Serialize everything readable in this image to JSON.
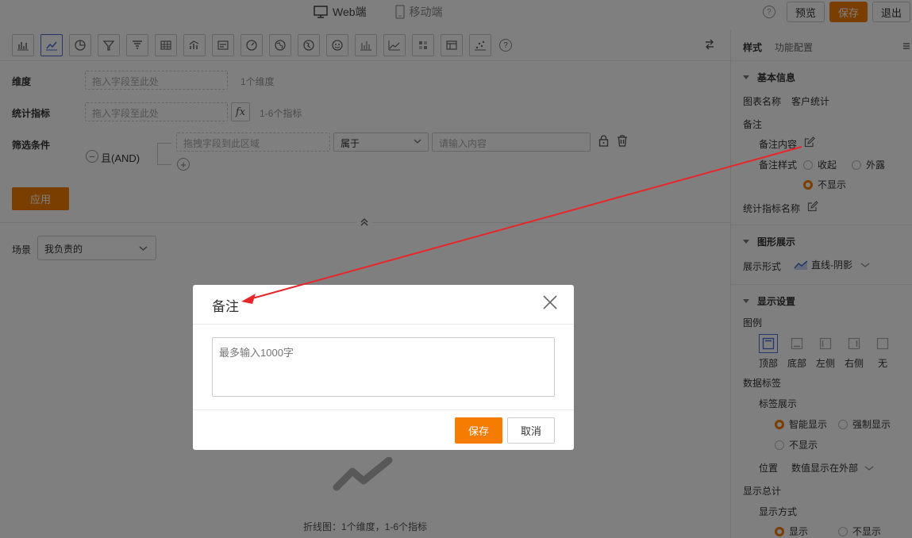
{
  "topbar": {
    "web_label": "Web端",
    "mobile_label": "移动端",
    "preview": "预览",
    "save": "保存",
    "exit": "退出"
  },
  "toolbar": {
    "chart_types": [
      "bar-chart-icon",
      "line-chart-icon",
      "pie-chart-icon",
      "funnel-icon",
      "funnel-alt-icon",
      "table-icon",
      "combo-chart-icon",
      "card-icon",
      "gauge-icon",
      "map-icon",
      "globe-icon",
      "dashboard-icon",
      "column-icon",
      "area-chart-icon",
      "matrix-icon",
      "detail-table-icon",
      "scatter-icon"
    ],
    "active_index": 1
  },
  "dimension": {
    "label": "维度",
    "placeholder": "拖入字段至此处",
    "hint": "1个维度"
  },
  "metric": {
    "label": "统计指标",
    "placeholder": "拖入字段至此处",
    "hint": "1-6个指标"
  },
  "filter": {
    "label": "筛选条件",
    "logic": "且(AND)",
    "field_placeholder": "拖拽字段到此区域",
    "operator": "属于",
    "value_placeholder": "请输入内容"
  },
  "apply_label": "应用",
  "scene": {
    "label": "场景",
    "value": "我负责的"
  },
  "empty": {
    "text": "折线图：1个维度，1-6个指标"
  },
  "panel": {
    "tabs": [
      "样式",
      "功能配置"
    ],
    "basic": {
      "title": "基本信息",
      "chart_name_label": "图表名称",
      "chart_name_value": "客户统计",
      "remark_label": "备注",
      "remark_content_label": "备注内容",
      "remark_style_label": "备注样式",
      "remark_styles": [
        "收起",
        "外露",
        "不显示"
      ],
      "metric_name_label": "统计指标名称"
    },
    "graph": {
      "title": "图形展示",
      "display_label": "展示形式",
      "display_value": "直线-阴影"
    },
    "display": {
      "title": "显示设置",
      "legend_label": "图例",
      "legend_options": [
        "顶部",
        "底部",
        "左侧",
        "右侧",
        "无"
      ],
      "data_label": "数据标签",
      "label_show": "标签展示",
      "label_options": [
        "智能显示",
        "强制显示",
        "不显示"
      ],
      "position_label": "位置",
      "position_value": "数值显示在外部",
      "total_label": "显示总计",
      "total_mode_label": "显示方式",
      "total_options": [
        "显示",
        "不显示"
      ]
    }
  },
  "modal": {
    "title": "备注",
    "placeholder": "最多输入1000字",
    "save": "保存",
    "cancel": "取消"
  },
  "colors": {
    "accent": "#f57c00",
    "active_border": "#4a6fd6",
    "annotation_arrow": "#e8262a"
  }
}
